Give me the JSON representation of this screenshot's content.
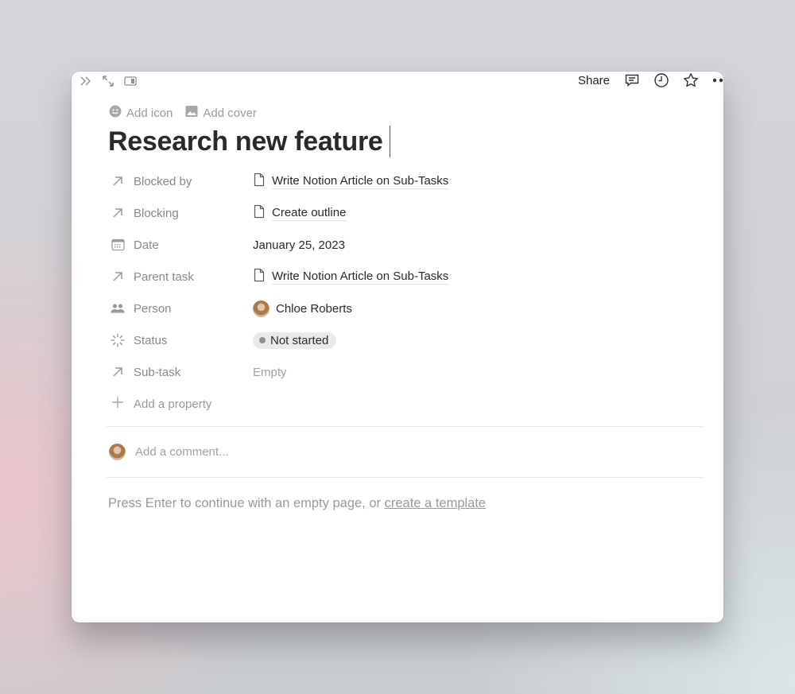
{
  "topbar": {
    "share_label": "Share",
    "left_icons": [
      "double-chevron-right-icon",
      "expand-arrows-icon",
      "side-peek-icon"
    ],
    "right_icons": [
      "comment-icon",
      "clock-history-icon",
      "star-icon",
      "more-dots-icon"
    ]
  },
  "page_actions": {
    "add_icon": "Add icon",
    "add_cover": "Add cover"
  },
  "page": {
    "title": "Research new feature"
  },
  "properties": [
    {
      "key": "Blocked by",
      "icon": "arrow-up-right-icon",
      "type": "relation",
      "value": "Write Notion Article on Sub-Tasks"
    },
    {
      "key": "Blocking",
      "icon": "arrow-up-right-icon",
      "type": "relation",
      "value": "Create outline"
    },
    {
      "key": "Date",
      "icon": "calendar-icon",
      "type": "date",
      "value": "January 25, 2023"
    },
    {
      "key": "Parent task",
      "icon": "arrow-up-right-icon",
      "type": "relation",
      "value": "Write Notion Article on Sub-Tasks"
    },
    {
      "key": "Person",
      "icon": "people-icon",
      "type": "person",
      "value": "Chloe Roberts"
    },
    {
      "key": "Status",
      "icon": "status-spinner-icon",
      "type": "status",
      "value": "Not started"
    },
    {
      "key": "Sub-task",
      "icon": "arrow-up-right-icon",
      "type": "relation",
      "value": "Empty"
    }
  ],
  "add_property_label": "Add a property",
  "comment": {
    "placeholder": "Add a comment..."
  },
  "hint": {
    "text": "Press Enter to continue with an empty page, or ",
    "link": "create a template"
  },
  "colors": {
    "text_primary": "#2a2a28",
    "text_secondary": "#8a8985",
    "status_pill_bg": "#ebeae8"
  }
}
